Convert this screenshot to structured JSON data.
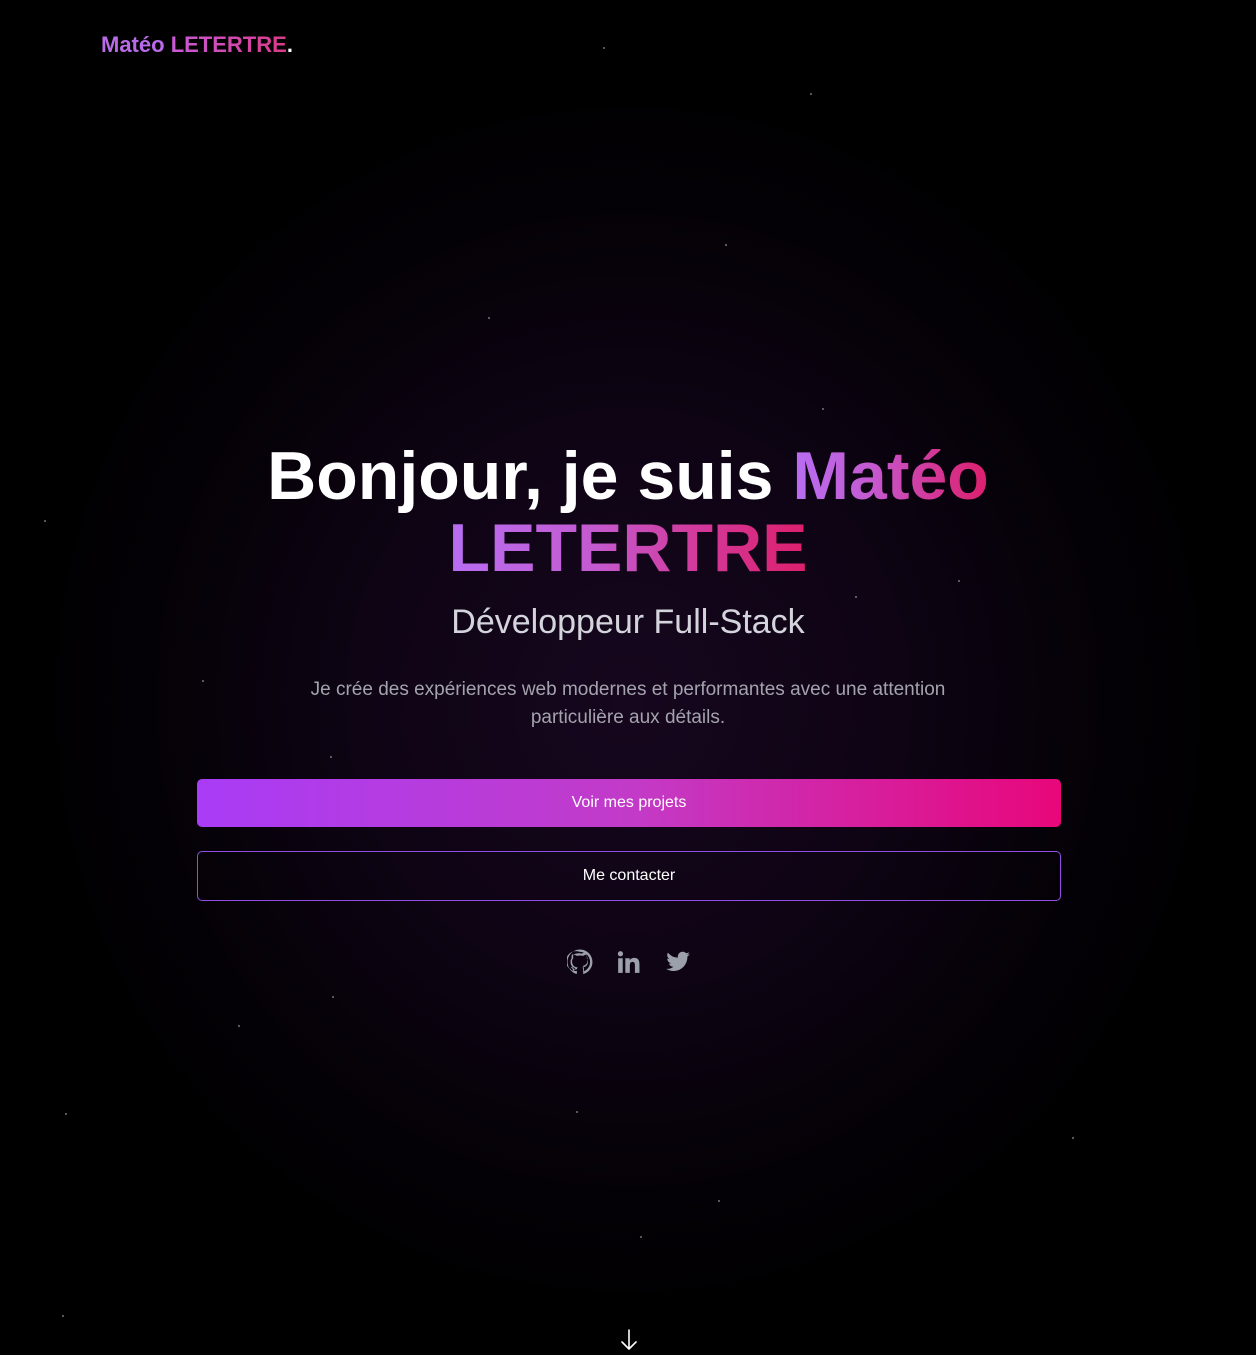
{
  "header": {
    "logo_first": "Matéo",
    "logo_last": "LETERTRE",
    "logo_dot": "."
  },
  "hero": {
    "greeting": "Bonjour, je suis",
    "name_first": "Matéo",
    "name_last": "LETERTRE",
    "role": "Développeur Full-Stack",
    "description": "Je crée des expériences web modernes et performantes avec une attention particulière aux détails."
  },
  "actions": {
    "primary_label": "Voir mes projets",
    "secondary_label": "Me contacter"
  },
  "socials": [
    {
      "icon": "github-icon"
    },
    {
      "icon": "linkedin-icon"
    },
    {
      "icon": "twitter-icon"
    }
  ],
  "scroll_indicator": {
    "icon": "arrow-down-icon"
  },
  "colors": {
    "background": "#000000",
    "accent_purple": "#a93cf6",
    "accent_pink": "#e8077a",
    "text_muted": "#a3a3ad",
    "icon_gray": "#9ca0ab"
  }
}
